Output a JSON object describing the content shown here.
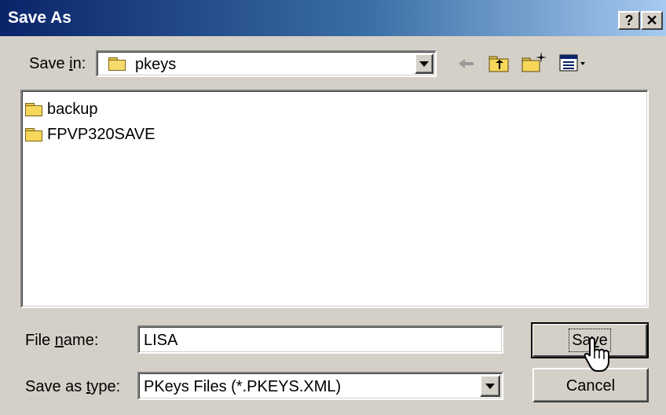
{
  "window": {
    "title": "Save As",
    "help_label": "?",
    "close_label": "✕"
  },
  "save_in": {
    "label_prefix": "Save ",
    "label_hotkey": "i",
    "label_suffix": "n:",
    "current_folder": "pkeys"
  },
  "toolbar": {
    "icons": [
      "back-icon",
      "up-folder-icon",
      "new-folder-icon",
      "view-menu-icon"
    ]
  },
  "files": [
    {
      "name": "backup",
      "icon": "folder-icon"
    },
    {
      "name": "FPVP320SAVE",
      "icon": "folder-icon"
    }
  ],
  "file_name": {
    "label_prefix": "File ",
    "label_hotkey": "n",
    "label_suffix": "ame:",
    "value": "LISA"
  },
  "save_type": {
    "label_prefix": "Save as ",
    "label_hotkey": "t",
    "label_suffix": "ype:",
    "value": "PKeys Files (*.PKEYS.XML)"
  },
  "buttons": {
    "save_prefix": "Sa",
    "save_hotkey": "v",
    "save_suffix": "e",
    "cancel": "Cancel"
  },
  "colors": {
    "titlebar_start": "#0a246a",
    "titlebar_end": "#a6caf0",
    "face": "#d4d0c8"
  }
}
